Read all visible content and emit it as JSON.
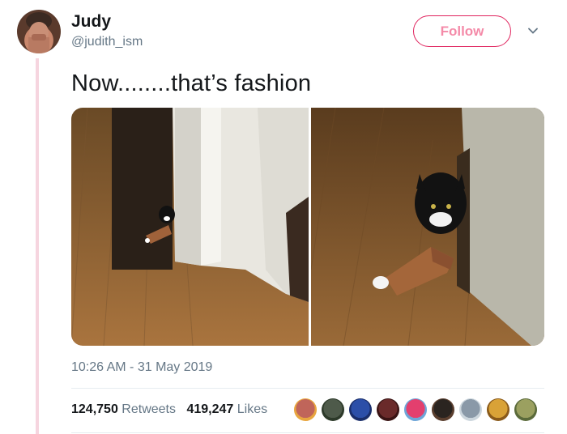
{
  "user": {
    "name": "Judy",
    "handle": "@judith_ism"
  },
  "follow_label": "Follow",
  "tweet": {
    "text": "Now........that’s fashion",
    "timestamp": "10:26 AM - 31 May 2019"
  },
  "stats": {
    "retweets_count": "124,750",
    "retweets_label": "Retweets",
    "likes_count": "419,247",
    "likes_label": "Likes"
  },
  "likers": [
    {
      "name": "liker-1",
      "color": "#c0655a",
      "ring": "#e8a640"
    },
    {
      "name": "liker-2",
      "color": "#4e5a4a",
      "ring": "#2d3a2a"
    },
    {
      "name": "liker-3",
      "color": "#2c4fa8",
      "ring": "#1a2e6a"
    },
    {
      "name": "liker-4",
      "color": "#6a2a2a",
      "ring": "#3a1414"
    },
    {
      "name": "liker-5",
      "color": "#e33f6e",
      "ring": "#6fa6d8"
    },
    {
      "name": "liker-6",
      "color": "#2a2420",
      "ring": "#5a3e2e"
    },
    {
      "name": "liker-7",
      "color": "#8a99a8",
      "ring": "#ccd6dd"
    },
    {
      "name": "liker-8",
      "color": "#d9a237",
      "ring": "#8a5a1a"
    },
    {
      "name": "liker-9",
      "color": "#9ba060",
      "ring": "#5a6a3a"
    }
  ],
  "colors": {
    "accent": "#e0245e",
    "secondary_text": "#657786",
    "thread_line": "#f6d5df"
  }
}
